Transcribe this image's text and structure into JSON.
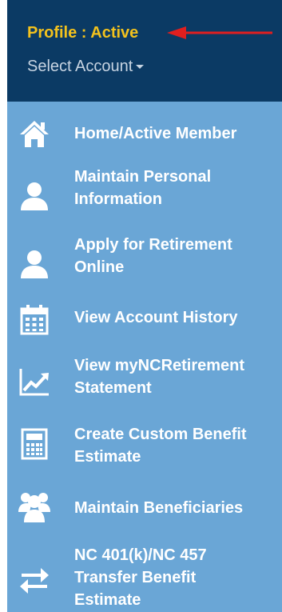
{
  "header": {
    "profile_label": "Profile : Active",
    "select_account_label": "Select Account"
  },
  "menu": {
    "items": [
      {
        "label": "Home/Active Member",
        "icon": "home-icon"
      },
      {
        "label_line1": "Maintain Personal",
        "label_line2": "Information",
        "icon": "user-icon"
      },
      {
        "label_line1": "Apply for Retirement",
        "label_line2": "Online",
        "icon": "user-icon"
      },
      {
        "label": "View Account History",
        "icon": "calendar-icon"
      },
      {
        "label_line1": "View myNCRetirement",
        "label_line2": "Statement",
        "icon": "chart-line-icon"
      },
      {
        "label_line1": "Create Custom Benefit",
        "label_line2": "Estimate",
        "icon": "calculator-icon"
      },
      {
        "label": "Maintain Beneficiaries",
        "icon": "users-icon"
      },
      {
        "label_line1": "NC 401(k)/NC 457",
        "label_line2": "Transfer Benefit",
        "label_line3": "Estimate",
        "icon": "transfer-icon"
      }
    ]
  },
  "colors": {
    "header_bg": "#0b3a64",
    "menu_bg": "#6aa6d6",
    "profile_text": "#f3c21d",
    "annotation_arrow": "#e01f1f"
  }
}
